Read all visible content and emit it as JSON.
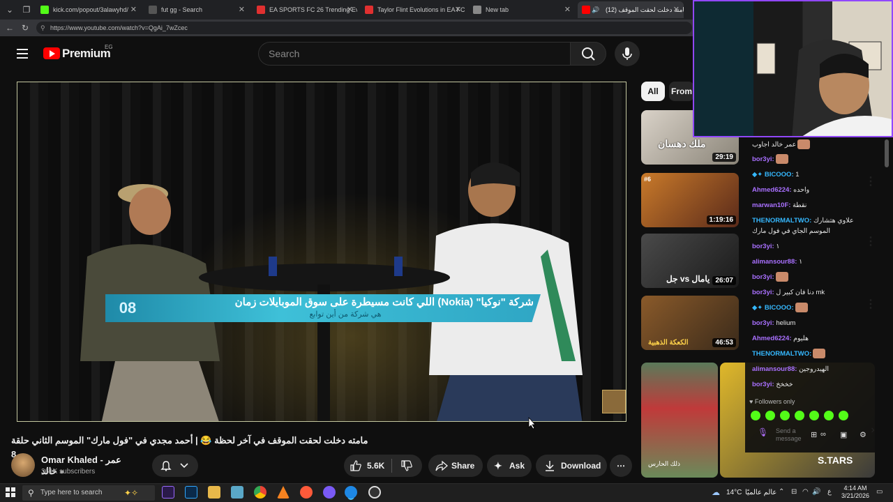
{
  "browser": {
    "tabs": [
      {
        "title": "kick.com/popout/3alawyhd/",
        "favicon_color": "#53fc18"
      },
      {
        "title": "fut gg - Search",
        "favicon_color": "#555555"
      },
      {
        "title": "EA SPORTS FC 26 Trending Evoluti",
        "favicon_color": "#e03030"
      },
      {
        "title": "Taylor Flint Evolutions in EA FC 2",
        "favicon_color": "#e03030"
      },
      {
        "title": "New tab",
        "favicon_color": "#888888"
      },
      {
        "title": "(12) مامته دخلت لحقت الموقف",
        "favicon_color": "#ff0000"
      }
    ],
    "url": "https://www.youtube.com/watch?v=QgAi_7wZcec"
  },
  "youtube": {
    "logo_text": "Premium",
    "region": "EG",
    "search_placeholder": "Search",
    "video": {
      "overlay_number": "08",
      "overlay_text": "شركة \"نوكيا\" (Nokia) اللي كانت مسيطرة على سوق الموبايلات زمان",
      "overlay_subtext": "هي شركة من أين توابع",
      "title": "مامته دخلت لحقت الموقف في آخر لحظة 😂 | أحمد مجدي في \"فول مارك\" الموسم الثاني حلقة 8",
      "channel_name": "Omar Khaled - عمر خالد",
      "subscribers": "361K subscribers",
      "likes": "5.6K",
      "share_label": "Share",
      "ask_label": "Ask",
      "download_label": "Download"
    },
    "chips": [
      "All",
      "From"
    ],
    "recommended": [
      {
        "duration": "29:19",
        "color": "#c9c2b8",
        "overlay_text": "ملك دهسان"
      },
      {
        "duration": "1:19:16",
        "color": "#b86a2a",
        "overlay_text": "#6"
      },
      {
        "duration": "26:07",
        "color": "#3a3a3a",
        "overlay_text": "جل vs يامال"
      },
      {
        "duration": "46:53",
        "color": "#6a4a2a",
        "overlay_text": "الكعكة الذهبية"
      }
    ],
    "shorts": [
      {
        "color": "#e05a4a",
        "overlay_text": "ذلك الحارس"
      },
      {
        "color": "#e0b82a",
        "overlay_text": "S.TARS"
      }
    ]
  },
  "chat": {
    "messages": [
      {
        "user": "",
        "text": "عمر خالد اجاوب",
        "color": "#e8e8e8",
        "emote": true
      },
      {
        "user": "bor3yi:",
        "text": "",
        "color": "#a970ff",
        "emote": true
      },
      {
        "user": "BICOOO:",
        "text": "1",
        "color": "#35b8ff",
        "emote": false
      },
      {
        "user": "Ahmed6224:",
        "text": "واحده",
        "color": "#a970ff",
        "emote": false
      },
      {
        "user": "marwan10F:",
        "text": "نقطة",
        "color": "#a970ff",
        "emote": false
      },
      {
        "user": "THENORMALTWO:",
        "text": "علاوي هتشارك",
        "color": "#35b8ff",
        "emote": false
      },
      {
        "user": "",
        "text": "الموسم الجاي في فول مارك",
        "color": "#e8e8e8",
        "emote": false
      },
      {
        "user": "bor3yi:",
        "text": "١",
        "color": "#a970ff",
        "emote": false
      },
      {
        "user": "alimansour88:",
        "text": "١",
        "color": "#a970ff",
        "emote": false
      },
      {
        "user": "bor3yi:",
        "text": "",
        "color": "#a970ff",
        "emote": true
      },
      {
        "user": "bor3yi:",
        "text": "دنا فان كبير ل mk",
        "color": "#a970ff",
        "emote": false
      },
      {
        "user": "BICOOO:",
        "text": "",
        "color": "#35b8ff",
        "emote": true
      },
      {
        "user": "bor3yi:",
        "text": "helium",
        "color": "#a970ff",
        "emote": false
      },
      {
        "user": "Ahmed6224:",
        "text": "هليوم",
        "color": "#a970ff",
        "emote": false
      },
      {
        "user": "THENORMALTWO:",
        "text": "",
        "color": "#35b8ff",
        "emote": true
      },
      {
        "user": "alimansour88:",
        "text": "الهيدروجين",
        "color": "#a970ff",
        "emote": false
      },
      {
        "user": "bor3yi:",
        "text": "خخخخ",
        "color": "#a970ff",
        "emote": false
      }
    ],
    "followers_only": "Followers only",
    "input_placeholder": "Send a message"
  },
  "taskbar": {
    "search_placeholder": "Type here to search",
    "weather_temp": "14°C",
    "weather_text": "عالم عالميًا",
    "time": "4:14 AM",
    "date": "3/21/2026"
  }
}
